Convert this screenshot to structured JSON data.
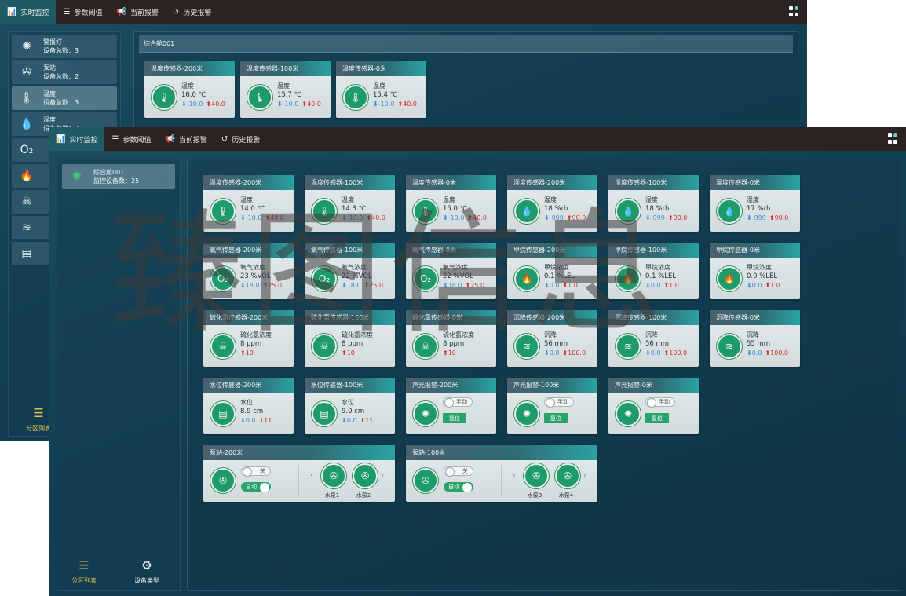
{
  "tabs": [
    {
      "icon": "bar-chart-icon",
      "glyph": "📊",
      "label": "实时监控",
      "active": true
    },
    {
      "icon": "sliders-icon",
      "glyph": "☰",
      "label": "参数阈值"
    },
    {
      "icon": "megaphone-icon",
      "glyph": "📢",
      "label": "当前报警"
    },
    {
      "icon": "history-icon",
      "glyph": "↺",
      "label": "历史报警"
    }
  ],
  "back": {
    "side_items": [
      {
        "icon": "alarm-light-icon",
        "title": "警报灯",
        "count": "设备总数：3"
      },
      {
        "icon": "pump-icon",
        "title": "泵站",
        "count": "设备总数：2"
      },
      {
        "icon": "thermometer-icon",
        "title": "温度",
        "count": "设备总数：3"
      },
      {
        "icon": "humidity-icon",
        "title": "湿度",
        "count": "设备总数：3"
      },
      {
        "icon": "oxygen-icon",
        "title": "",
        "count": ""
      },
      {
        "icon": "flame-icon",
        "title": "",
        "count": ""
      },
      {
        "icon": "skull-icon",
        "title": "",
        "count": ""
      },
      {
        "icon": "settlement-icon",
        "title": "",
        "count": ""
      },
      {
        "icon": "water-level-icon",
        "title": "",
        "count": ""
      }
    ],
    "footer_label": "分区列表",
    "group_title": "综合舱001",
    "cards": [
      {
        "title": "温度传感器-200米",
        "label": "温度",
        "value": "16.0 ℃",
        "low": "-10.0",
        "high": "40.0"
      },
      {
        "title": "温度传感器-100米",
        "label": "温度",
        "value": "15.7 ℃",
        "low": "-10.0",
        "high": "40.0"
      },
      {
        "title": "温度传感器-0米",
        "label": "温度",
        "value": "15.4 ℃",
        "low": "-10.0",
        "high": "40.0"
      }
    ]
  },
  "front": {
    "zone": {
      "title": "综合舱001",
      "count": "监控设备数：25"
    },
    "footer": [
      {
        "icon": "list-icon",
        "label": "分区列表",
        "active": true
      },
      {
        "icon": "device-type-icon",
        "label": "设备类型"
      }
    ],
    "cards": [
      {
        "title": "温度传感器-200米",
        "icon": "thermometer-icon",
        "label": "温度",
        "value": "14.0 ℃",
        "low": "-10.0",
        "high": "40.0"
      },
      {
        "title": "温度传感器-100米",
        "icon": "thermometer-icon",
        "label": "温度",
        "value": "14.3 ℃",
        "low": "-10.0",
        "high": "40.0"
      },
      {
        "title": "温度传感器-0米",
        "icon": "thermometer-icon",
        "label": "温度",
        "value": "15.0 ℃",
        "low": "-10.0",
        "high": "40.0"
      },
      {
        "title": "湿度传感器-200米",
        "icon": "humidity-icon",
        "label": "湿度",
        "value": "18 %rh",
        "low": "-999",
        "high": "90.0"
      },
      {
        "title": "湿度传感器-100米",
        "icon": "humidity-icon",
        "label": "湿度",
        "value": "18 %rh",
        "low": "-999",
        "high": "90.0"
      },
      {
        "title": "湿度传感器-0米",
        "icon": "humidity-icon",
        "label": "湿度",
        "value": "17 %rh",
        "low": "-999",
        "high": "90.0"
      },
      {
        "title": "氧气传感器-200米",
        "icon": "oxygen-icon",
        "label": "氧气浓度",
        "value": "23 %VOL",
        "low": "18.0",
        "high": "25.0"
      },
      {
        "title": "氧气传感器-100米",
        "icon": "oxygen-icon",
        "label": "氧气浓度",
        "value": "22 %VOL",
        "low": "18.0",
        "high": "25.0"
      },
      {
        "title": "氧气传感器-0米",
        "icon": "oxygen-icon",
        "label": "氧气浓度",
        "value": "22 %VOL",
        "low": "18.0",
        "high": "25.0"
      },
      {
        "title": "甲烷传感器-200米",
        "icon": "flame-icon",
        "label": "甲烷浓度",
        "value": "0.1 %LEL",
        "low": "0.0",
        "high": "1.0"
      },
      {
        "title": "甲烷传感器-100米",
        "icon": "flame-icon",
        "label": "甲烷浓度",
        "value": "0.1 %LEL",
        "low": "0.0",
        "high": "1.0"
      },
      {
        "title": "甲烷传感器-0米",
        "icon": "flame-icon",
        "label": "甲烷浓度",
        "value": "0.0 %LEL",
        "low": "0.0",
        "high": "1.0"
      },
      {
        "title": "硫化氢传感器-200米",
        "icon": "skull-icon",
        "label": "硫化氢浓度",
        "value": "8 ppm",
        "low": "",
        "high": "10"
      },
      {
        "title": "硫化氢传感器-100米",
        "icon": "skull-icon",
        "label": "硫化氢浓度",
        "value": "8 ppm",
        "low": "",
        "high": "10"
      },
      {
        "title": "硫化氢传感器-0米",
        "icon": "skull-icon",
        "label": "硫化氢浓度",
        "value": "8 ppm",
        "low": "",
        "high": "10"
      },
      {
        "title": "沉降传感器-200米",
        "icon": "settlement-icon",
        "label": "沉降",
        "value": "56 mm",
        "low": "0.0",
        "high": "100.0"
      },
      {
        "title": "沉降传感器-100米",
        "icon": "settlement-icon",
        "label": "沉降",
        "value": "56 mm",
        "low": "0.0",
        "high": "100.0"
      },
      {
        "title": "沉降传感器-0米",
        "icon": "settlement-icon",
        "label": "沉降",
        "value": "55 mm",
        "low": "0.0",
        "high": "100.0"
      },
      {
        "title": "水位传感器-200米",
        "icon": "water-level-icon",
        "label": "水位",
        "value": "8.9 cm",
        "low": "0.0",
        "high": "11"
      },
      {
        "title": "水位传感器-100米",
        "icon": "water-level-icon",
        "label": "水位",
        "value": "9.0 cm",
        "low": "0.0",
        "high": "11"
      }
    ],
    "alarms": [
      {
        "title": "声光报警-200米",
        "toggle": "手动",
        "reset": "复位"
      },
      {
        "title": "声光报警-100米",
        "toggle": "手动",
        "reset": "复位"
      },
      {
        "title": "声光报警-0米",
        "toggle": "手动",
        "reset": "复位"
      }
    ],
    "pumps": [
      {
        "title": "泵站-200米",
        "off": "关",
        "auto": "自动",
        "pump_a": "水泵1",
        "pump_b": "水泵2"
      },
      {
        "title": "泵站-100米",
        "off": "关",
        "auto": "自动",
        "pump_a": "水泵3",
        "pump_b": "水泵4"
      }
    ]
  },
  "watermark": "臻图信息"
}
